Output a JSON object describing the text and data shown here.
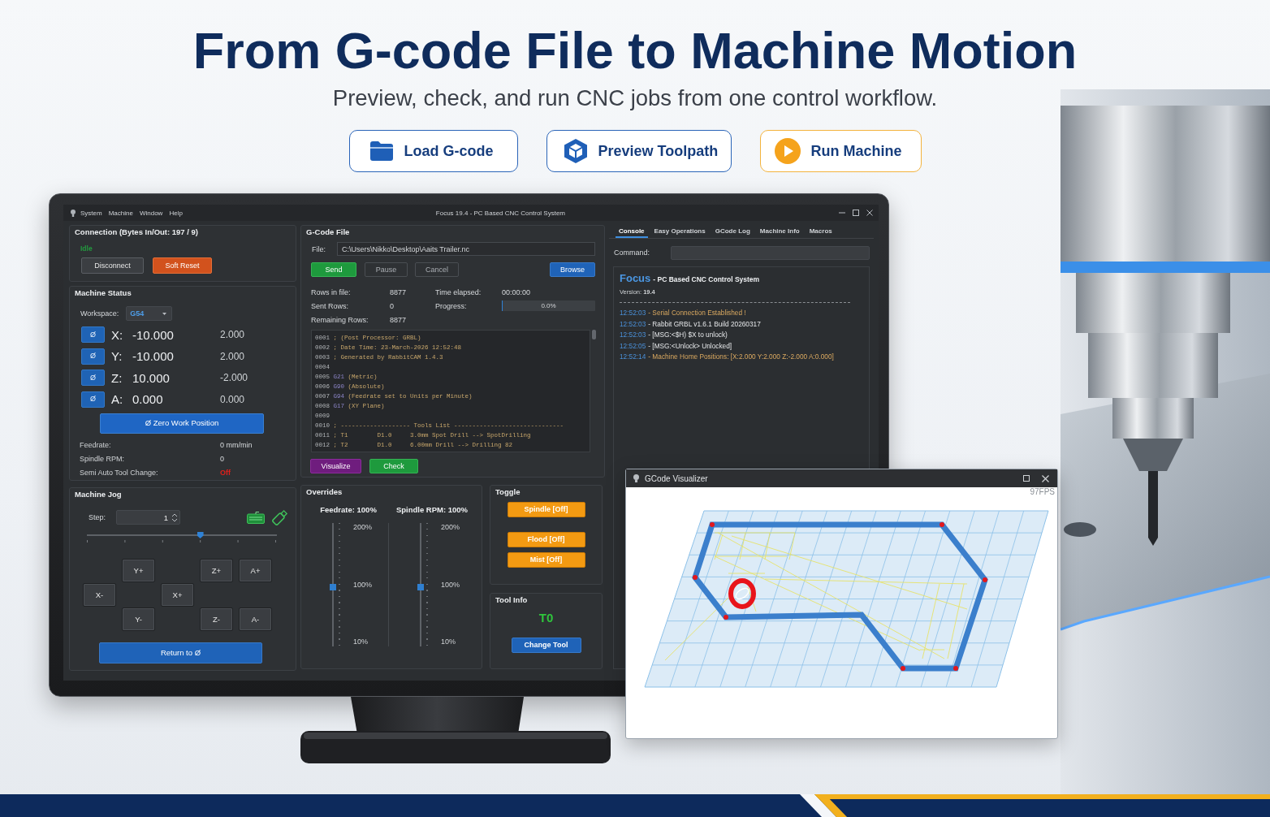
{
  "hero": {
    "title": "From G-code File to Machine Motion",
    "subtitle": "Preview, check, and run CNC jobs from one control workflow.",
    "actions": [
      {
        "kind": "load",
        "label": "Load G-code"
      },
      {
        "kind": "preview",
        "label": "Preview Toolpath"
      },
      {
        "kind": "run",
        "label": "Run Machine"
      }
    ]
  },
  "window": {
    "menu": [
      "System",
      "Machine",
      "Window",
      "Help"
    ],
    "title": "Focus 19.4 - PC Based CNC Control System"
  },
  "connection": {
    "title": "Connection (Bytes In/Out: 197 / 9)",
    "state": "Idle",
    "buttons": [
      {
        "kind": "disconnect",
        "label": "Disconnect"
      },
      {
        "kind": "reset",
        "label": "Soft Reset"
      }
    ]
  },
  "machine_status": {
    "title": "Machine Status",
    "workspace_label": "Workspace:",
    "workspace": "G54",
    "axes": [
      {
        "zero": "Ø",
        "axis": "X:",
        "work": "-10.000",
        "machine": "2.000"
      },
      {
        "zero": "Ø",
        "axis": "Y:",
        "work": "-10.000",
        "machine": "2.000"
      },
      {
        "zero": "Ø",
        "axis": "Z:",
        "work": "10.000",
        "machine": "-2.000"
      },
      {
        "zero": "Ø",
        "axis": "A:",
        "work": "0.000",
        "machine": "0.000"
      }
    ],
    "zero_button": "Ø Zero Work Position",
    "readouts": [
      {
        "kind": "normal",
        "label": "Feedrate:",
        "value": "0 mm/min"
      },
      {
        "kind": "normal",
        "label": "Spindle RPM:",
        "value": "0"
      },
      {
        "kind": "alert",
        "label": "Semi Auto Tool Change:",
        "value": "Off"
      }
    ]
  },
  "machine_jog": {
    "title": "Machine Jog",
    "step_label": "Step:",
    "step": "1",
    "step_slider": {
      "level": 0.6
    },
    "buttons": [
      "Y+",
      "Z+",
      "A+",
      "X-",
      "X+",
      "Y-",
      "Z-",
      "A-"
    ],
    "return_button": "Return to Ø"
  },
  "gcode_file": {
    "title": "G-Code File",
    "file_label": "File:",
    "file": "C:\\Users\\Nikko\\Desktop\\Aaits Trailer.nc",
    "buttons": [
      {
        "kind": "send",
        "label": "Send"
      },
      {
        "kind": "pause",
        "label": "Pause"
      },
      {
        "kind": "cancel",
        "label": "Cancel"
      },
      {
        "kind": "browse",
        "label": "Browse"
      }
    ],
    "stats": [
      {
        "label": "Rows in file:",
        "value": "8877"
      },
      {
        "label": "Sent Rows:",
        "value": "0"
      },
      {
        "label": "Remaining Rows:",
        "value": "8877"
      }
    ],
    "elapsed": {
      "label": "Time elapsed:",
      "value": "00:00:00"
    },
    "progress": {
      "label": "Progress:",
      "reading": "0.0%",
      "level": 0
    },
    "lines": [
      {
        "num": "0001",
        "text": "; (Post Processor: GRBL)"
      },
      {
        "num": "0002",
        "text": "; Date Time: 23-March-2026 12:52:48"
      },
      {
        "num": "0003",
        "text": "; Generated by RabbitCAM 1.4.3"
      },
      {
        "num": "0004"
      },
      {
        "num": "0005",
        "code": "G21",
        "text": "(Metric)"
      },
      {
        "num": "0006",
        "code": "G90",
        "text": "(Absolute)"
      },
      {
        "num": "0007",
        "code": "G94",
        "text": "(Feedrate set to Units per Minute)"
      },
      {
        "num": "0008",
        "code": "G17",
        "text": "(XY Plane)"
      },
      {
        "num": "0009"
      },
      {
        "num": "0010",
        "text": "; ------------------- Tools List ------------------------------"
      },
      {
        "num": "0011",
        "text": "; T1        D1.0     3.0mm Spot Drill --> SpotDrilling"
      },
      {
        "num": "0012",
        "text": "; T2        D1.0     6.00mm Drill --> Drilling 82"
      }
    ],
    "actions": [
      {
        "kind": "visualize",
        "label": "Visualize"
      },
      {
        "kind": "check",
        "label": "Check"
      }
    ]
  },
  "overrides": {
    "title": "Overrides",
    "sliders": [
      {
        "label": "Feedrate: 100%",
        "ticks": [
          "200%",
          "100%",
          "10%"
        ],
        "level": 0.48
      },
      {
        "label": "Spindle RPM: 100%",
        "ticks": [
          "200%",
          "100%",
          "10%"
        ],
        "level": 0.48
      }
    ]
  },
  "toggle": {
    "title": "Toggle",
    "buttons": [
      {
        "label": "Spindle [Off]",
        "on": false
      },
      {
        "label": "Flood [Off]",
        "on": false
      },
      {
        "label": "Mist [Off]",
        "on": false
      }
    ]
  },
  "tool_info": {
    "title": "Tool Info",
    "tool": "T0",
    "button": "Change Tool"
  },
  "console": {
    "tabs": [
      {
        "label": "Console",
        "selected": true
      },
      {
        "label": "Easy Operations",
        "selected": false
      },
      {
        "label": "GCode Log",
        "selected": false
      },
      {
        "label": "Machine Info",
        "selected": false
      },
      {
        "label": "Macros",
        "selected": false
      }
    ],
    "command_label": "Command:",
    "brand": "Focus",
    "tagline": "- PC Based CNC Control System",
    "version": "Version: **19.4**",
    "log": [
      {
        "kind": "status",
        "time": "12:52:03",
        "message": "- Serial Connection Established !"
      },
      {
        "kind": "reply",
        "time": "12:52:03",
        "message": "- Rabbit GRBL v1.6.1 Build 20260317"
      },
      {
        "kind": "reply",
        "time": "12:52:03",
        "message": "- [MSG:<$H) $X to unlock)"
      },
      {
        "kind": "reply",
        "time": "12:52:05",
        "message": "- [MSG:<Unlock> Unlocked]"
      },
      {
        "kind": "status",
        "time": "12:52:14",
        "message": "- Machine Home Positions: [X:2.000 Y:2.000 Z:-2.000 A:0.000]"
      }
    ]
  },
  "visualizer": {
    "title": "GCode Visualizer",
    "fps": "97FPS"
  }
}
